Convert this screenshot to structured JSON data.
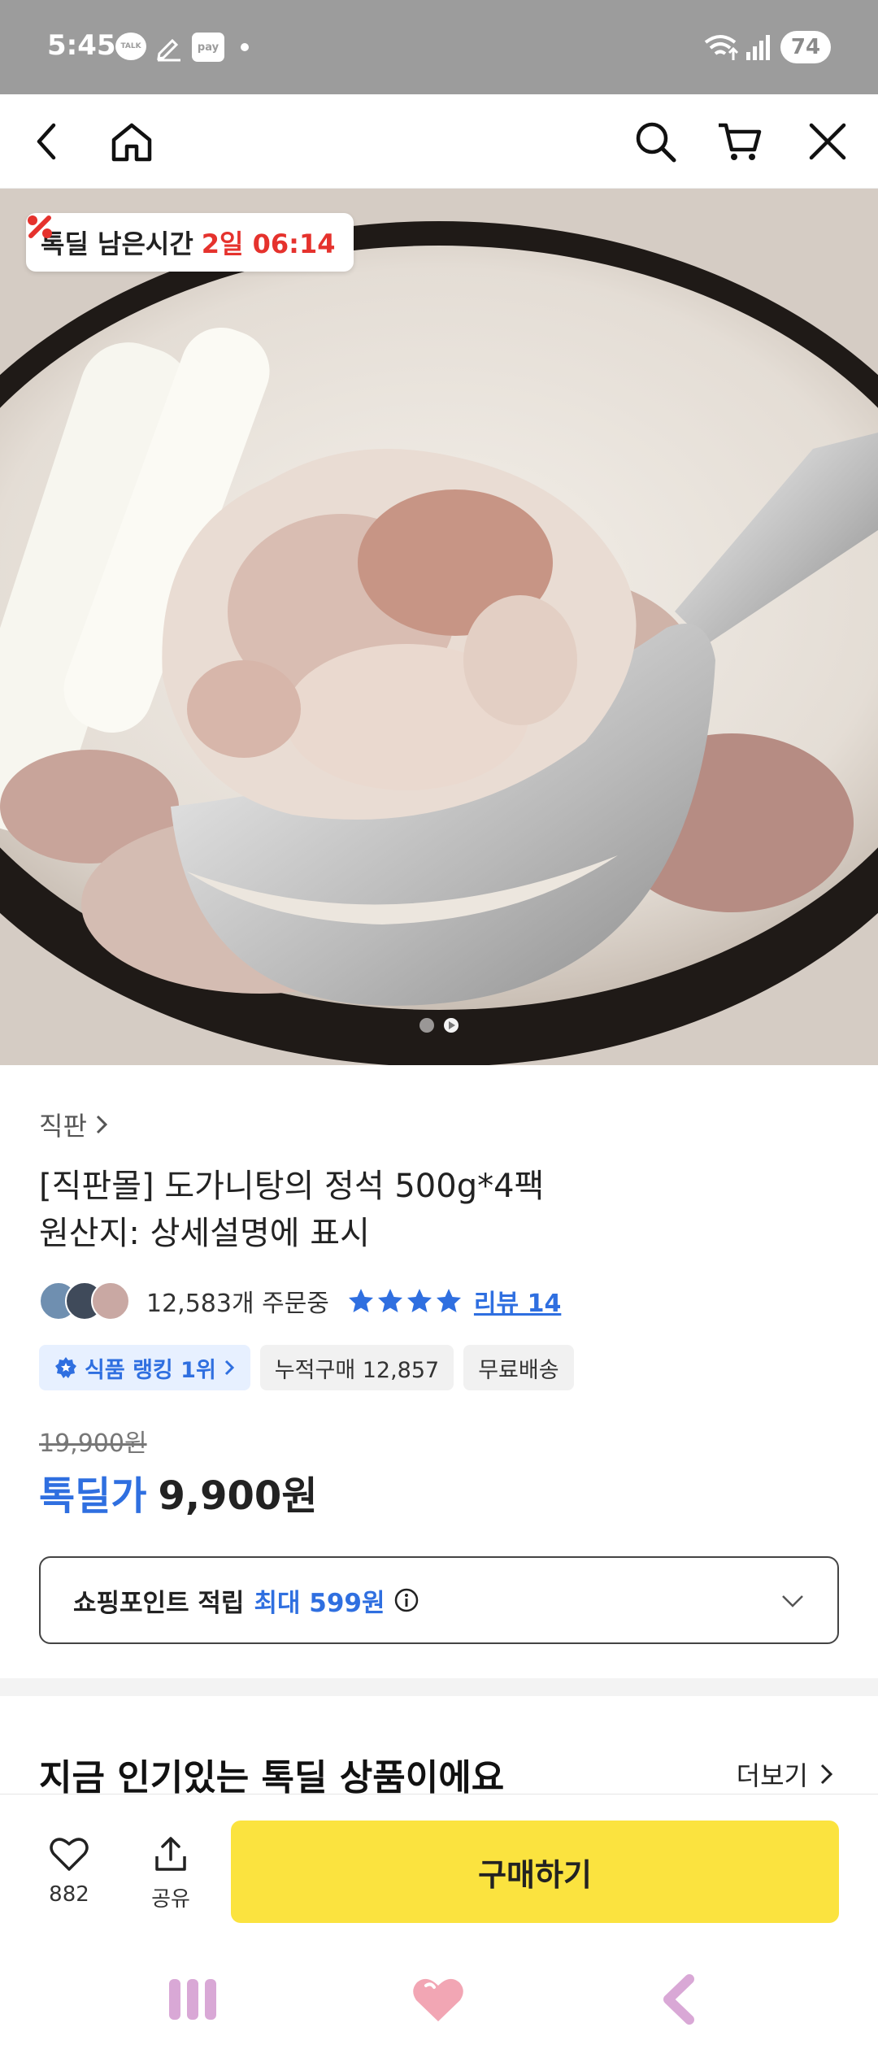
{
  "status_bar": {
    "time": "5:45",
    "talk_icon_text": "TALK",
    "pay_icon_text": "pay",
    "battery": "74"
  },
  "top_nav": {
    "icons": [
      "back-icon",
      "home-icon",
      "search-icon",
      "cart-icon",
      "close-icon"
    ]
  },
  "hero": {
    "deal_label": "톡딜 남은시간",
    "deal_time": "2일 06:14",
    "slides": 2,
    "active_slide": 2
  },
  "product": {
    "seller": "직판",
    "title_line1": "[직판몰] 도가니탕의 정석 500g*4팩",
    "title_line2": "원산지: 상세설명에 표시",
    "order_count": "12,583개 주문중",
    "rating_stars": 4,
    "review_label": "리뷰 14",
    "tags": {
      "rank": "식품 랭킹 1위",
      "cumulative": "누적구매 12,857",
      "shipping": "무료배송"
    },
    "original_price": "19,900원",
    "sale_label": "톡딜가",
    "sale_price": "9,900원",
    "point_label": "쇼핑포인트 적립",
    "point_max": "최대 599원"
  },
  "section": {
    "title": "지금 인기있는 톡딜 상품이에요",
    "more": "더보기"
  },
  "action_bar": {
    "like_count": "882",
    "share_label": "공유",
    "buy_label": "구매하기"
  },
  "colors": {
    "accent_blue": "#2f6fe0",
    "buy_yellow": "#fbe33f",
    "timer_red": "#e5322d",
    "star_blue": "#2f6fe0"
  }
}
